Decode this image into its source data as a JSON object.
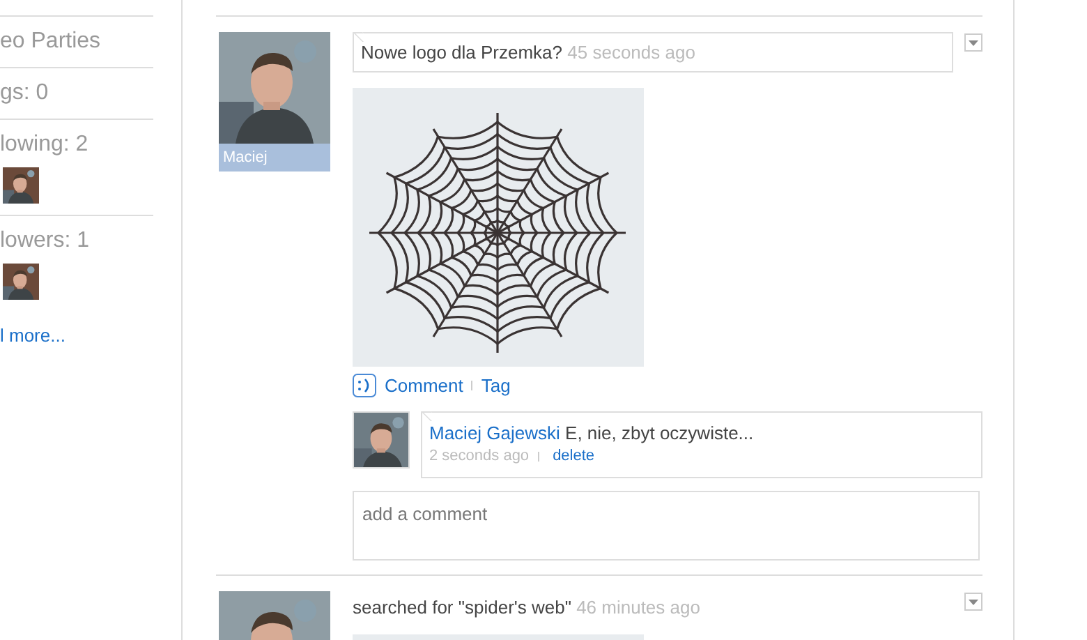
{
  "sidebar": {
    "items": [
      {
        "kind": "title",
        "text": "eo Parties"
      },
      {
        "kind": "stat",
        "text": "gs: 0"
      },
      {
        "kind": "stat",
        "text": "lowing: 2"
      },
      {
        "kind": "stat",
        "text": "lowers: 1"
      },
      {
        "kind": "link",
        "text": "l more..."
      }
    ]
  },
  "posts": [
    {
      "author": "Maciej",
      "message": "Nowe logo dla Przemka?",
      "time": "45 seconds ago",
      "attachment": {
        "kind": "web"
      },
      "actions": [
        "Comment",
        "Tag"
      ],
      "comments": [
        {
          "author": "Maciej Gajewski",
          "text": "E, nie, zbyt oczywiste...",
          "time": "2 seconds ago",
          "action": "delete"
        }
      ],
      "comment_field": {
        "placeholder": "add a comment"
      }
    },
    {
      "message": "searched for \"spider's web\"",
      "time": "46 minutes ago",
      "attachment": {
        "kind": "panel"
      }
    }
  ]
}
